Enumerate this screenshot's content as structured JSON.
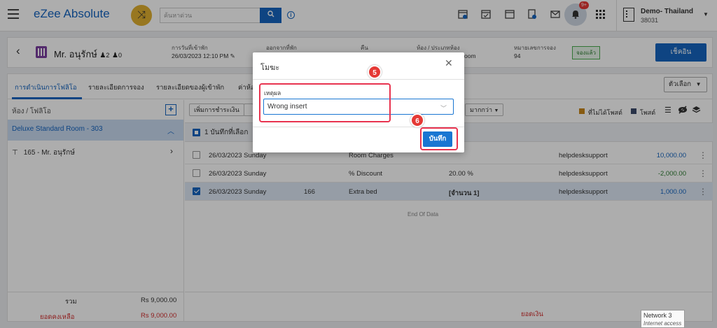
{
  "topbar": {
    "logo": "eZee Absolute",
    "search_placeholder": "ค้นหาด่วน",
    "hotel_name": "Demo- Thailand",
    "hotel_id": "38031",
    "notification_count": "9+"
  },
  "guest_bar": {
    "guest_name": "Mr. อนุรักษ์",
    "adults": "2",
    "children": "0",
    "checkin_label": "การวันที่เข้าพัก",
    "checkin_value": "26/03/2023 12:10 PM",
    "checkout_label": "ออกจากที่พัก",
    "nights_label": "คืน",
    "room_label": "ห้อง / ประเภทห้อง",
    "room_value_partial": "oom",
    "reservation_label": "หมายเลขการจอง",
    "reservation_value": "94",
    "status": "จองแล้ว",
    "checkin_button": "เช็คอิน"
  },
  "tabs": [
    {
      "label": "การดำเนินการโฟลิโอ"
    },
    {
      "label": "รายละเอียดการจอง"
    },
    {
      "label": "รายละเอียดของผู้เข้าพัก"
    },
    {
      "label": "ค่าห้อ"
    }
  ],
  "options_button": "ตัวเลือก",
  "sidebar": {
    "header": "ห้อง / โฟลิโอ",
    "room": "Deluxe Standard Room - 303",
    "guest_folio": "165 - Mr. อนุรักษ์",
    "total_label": "รวม",
    "total_value": "Rs 9,000.00",
    "balance_label": "ยอดคงเหลือ",
    "balance_value": "Rs 9,000.00"
  },
  "toolbar": {
    "add_payment": "เพิ่มการชำระเงิน",
    "more": "มากกว่า",
    "legend_unposted": "ที่ไม่ได้โพสต์",
    "legend_posted": "โพสต์"
  },
  "select_bar": {
    "label": "1 บันทึกที่เลือก"
  },
  "rows": [
    {
      "date": "26/03/2023 Sunday",
      "ref": "",
      "desc": "Room Charges",
      "info": "",
      "user": "helpdesksupport",
      "amount": "10,000.00"
    },
    {
      "date": "26/03/2023 Sunday",
      "ref": "",
      "desc": "% Discount",
      "info": "20.00 %",
      "user": "helpdesksupport",
      "amount": "-2,000.00"
    },
    {
      "date": "26/03/2023 Sunday",
      "ref": "166",
      "desc": "Extra bed",
      "info": "[จำนวน 1]",
      "user": "helpdesksupport",
      "amount": "1,000.00"
    }
  ],
  "end_of_data": "End Of Data",
  "content_footer": {
    "balance_label": "ยอดเงิน"
  },
  "modal": {
    "title": "โมฆะ",
    "reason_label": "เหตุผล",
    "reason_value": "Wrong insert",
    "save_button": "บันทึก"
  },
  "steps": [
    "5",
    "6"
  ],
  "tooltip": {
    "title": "Network 3",
    "subtitle": "Internet access"
  },
  "colors": {
    "primary": "#1565c0",
    "highlight": "#e8334f",
    "unposted": "#c8861a",
    "posted": "#3c4a6a"
  }
}
